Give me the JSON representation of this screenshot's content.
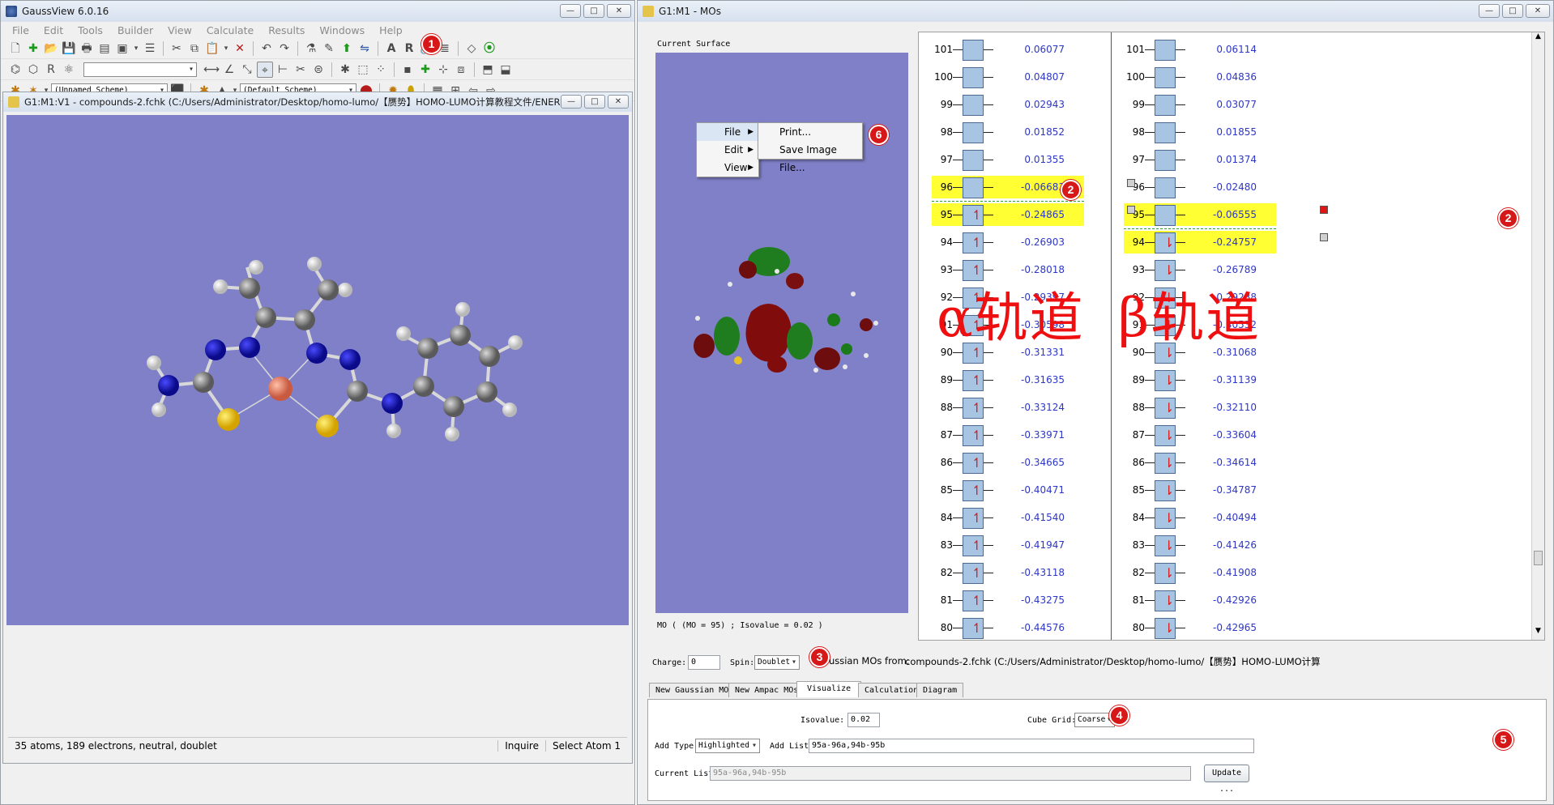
{
  "left_window": {
    "title": "GaussView 6.0.16",
    "menu": [
      "File",
      "Edit",
      "Tools",
      "Builder",
      "View",
      "Calculate",
      "Results",
      "Windows",
      "Help"
    ],
    "scheme1": "(Unnamed Scheme)",
    "scheme2": "(Default Scheme)",
    "view_title": "G1:M1:V1 - compounds-2.fchk (C:/Users/Administrator/Desktop/homo-lumo/【赝势】HOMO-LUMO计算教程文件/ENERGY结构文件/compou...",
    "status_left": "35 atoms, 189 electrons, neutral, doublet",
    "status_mode": "Inquire",
    "status_action": "Select Atom 1",
    "win_buttons": {
      "min": "▭",
      "max": "□",
      "close": "✕"
    }
  },
  "right_window": {
    "title": "G1:M1 - MOs",
    "current_surface": "Current Surface",
    "surface_caption": "MO ( (MO = 95) ; Isovalue = 0.02 )",
    "context_menu": {
      "items": [
        "File",
        "Edit",
        "View"
      ],
      "submenu": [
        "Print...",
        "Save Image File..."
      ]
    },
    "alpha_label": "α轨道",
    "beta_label": "β轨道",
    "alpha": [
      {
        "n": "101",
        "e": "0.06077",
        "occ": false,
        "hl": false
      },
      {
        "n": "100",
        "e": "0.04807",
        "occ": false,
        "hl": false
      },
      {
        "n": "99",
        "e": "0.02943",
        "occ": false,
        "hl": false
      },
      {
        "n": "98",
        "e": "0.01852",
        "occ": false,
        "hl": false
      },
      {
        "n": "97",
        "e": "0.01355",
        "occ": false,
        "hl": false
      },
      {
        "n": "96",
        "e": "-0.06683",
        "occ": false,
        "hl": true
      },
      {
        "n": "95",
        "e": "-0.24865",
        "occ": true,
        "hl": true
      },
      {
        "n": "94",
        "e": "-0.26903",
        "occ": true,
        "hl": false
      },
      {
        "n": "93",
        "e": "-0.28018",
        "occ": true,
        "hl": false
      },
      {
        "n": "92",
        "e": "-0.29397",
        "occ": true,
        "hl": false
      },
      {
        "n": "91",
        "e": "-0.30598",
        "occ": true,
        "hl": false
      },
      {
        "n": "90",
        "e": "-0.31331",
        "occ": true,
        "hl": false
      },
      {
        "n": "89",
        "e": "-0.31635",
        "occ": true,
        "hl": false
      },
      {
        "n": "88",
        "e": "-0.33124",
        "occ": true,
        "hl": false
      },
      {
        "n": "87",
        "e": "-0.33971",
        "occ": true,
        "hl": false
      },
      {
        "n": "86",
        "e": "-0.34665",
        "occ": true,
        "hl": false
      },
      {
        "n": "85",
        "e": "-0.40471",
        "occ": true,
        "hl": false
      },
      {
        "n": "84",
        "e": "-0.41540",
        "occ": true,
        "hl": false
      },
      {
        "n": "83",
        "e": "-0.41947",
        "occ": true,
        "hl": false
      },
      {
        "n": "82",
        "e": "-0.43118",
        "occ": true,
        "hl": false
      },
      {
        "n": "81",
        "e": "-0.43275",
        "occ": true,
        "hl": false
      },
      {
        "n": "80",
        "e": "-0.44576",
        "occ": true,
        "hl": false
      }
    ],
    "beta": [
      {
        "n": "101",
        "e": "0.06114",
        "occ": false,
        "hl": false
      },
      {
        "n": "100",
        "e": "0.04836",
        "occ": false,
        "hl": false
      },
      {
        "n": "99",
        "e": "0.03077",
        "occ": false,
        "hl": false
      },
      {
        "n": "98",
        "e": "0.01855",
        "occ": false,
        "hl": false
      },
      {
        "n": "97",
        "e": "0.01374",
        "occ": false,
        "hl": false
      },
      {
        "n": "96",
        "e": "-0.02480",
        "occ": false,
        "hl": false
      },
      {
        "n": "95",
        "e": "-0.06555",
        "occ": false,
        "hl": true
      },
      {
        "n": "94",
        "e": "-0.24757",
        "occ": true,
        "hl": true
      },
      {
        "n": "93",
        "e": "-0.26789",
        "occ": true,
        "hl": false
      },
      {
        "n": "92",
        "e": "-0.29238",
        "occ": true,
        "hl": false
      },
      {
        "n": "91",
        "e": "-0.30532",
        "occ": true,
        "hl": false
      },
      {
        "n": "90",
        "e": "-0.31068",
        "occ": true,
        "hl": false
      },
      {
        "n": "89",
        "e": "-0.31139",
        "occ": true,
        "hl": false
      },
      {
        "n": "88",
        "e": "-0.32110",
        "occ": true,
        "hl": false
      },
      {
        "n": "87",
        "e": "-0.33604",
        "occ": true,
        "hl": false
      },
      {
        "n": "86",
        "e": "-0.34614",
        "occ": true,
        "hl": false
      },
      {
        "n": "85",
        "e": "-0.34787",
        "occ": true,
        "hl": false
      },
      {
        "n": "84",
        "e": "-0.40494",
        "occ": true,
        "hl": false
      },
      {
        "n": "83",
        "e": "-0.41426",
        "occ": true,
        "hl": false
      },
      {
        "n": "82",
        "e": "-0.41908",
        "occ": true,
        "hl": false
      },
      {
        "n": "81",
        "e": "-0.42926",
        "occ": true,
        "hl": false
      },
      {
        "n": "80",
        "e": "-0.42965",
        "occ": true,
        "hl": false
      }
    ],
    "charge_label": "Charge:",
    "charge_value": "0",
    "spin_label": "Spin:",
    "spin_value": "Doublet",
    "mos_from_label": "Gaussian MOs from:",
    "mos_from_path": "compounds-2.fchk (C:/Users/Administrator/Desktop/homo-lumo/【赝势】HOMO-LUMO计算",
    "tabs": [
      "New Gaussian MOs",
      "New Ampac MOs",
      "Visualize",
      "Calculation",
      "Diagram"
    ],
    "active_tab": "Visualize",
    "isovalue_label": "Isovalue:",
    "isovalue": "0.02",
    "cubegrid_label": "Cube Grid:",
    "cubegrid": "Coarse",
    "addtype_label": "Add Type:",
    "addtype": "Highlighted",
    "addlist_label": "Add List:",
    "addlist": "95a-96a,94b-95b",
    "currentlist_label": "Current List:",
    "currentlist": "95a-96a,94b-95b",
    "update": "Update ..."
  },
  "markers": [
    "1",
    "2",
    "2",
    "3",
    "4",
    "5",
    "6"
  ],
  "colors": {
    "view_bg": "#8080c8",
    "highlight": "#ffff33",
    "energy": "#2d36c7",
    "marker": "#d61818",
    "occ_arrow": "#d62020"
  }
}
